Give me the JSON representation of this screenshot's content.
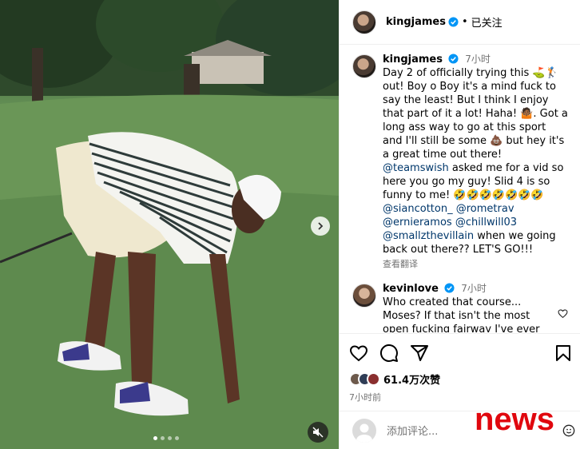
{
  "post": {
    "author": "kingjames",
    "follow_status": "已关注",
    "separator": "•",
    "caption_author": "kingjames",
    "caption_time": "7小时",
    "caption_part1": "Day 2 of officially trying this ⛳🏌 out! Boy o Boy it's a mind fuck to say the least! But I think I enjoy that part of it a lot! Haha! 🤷🏾. Got a long ass way to go at this sport and I'll still be some 💩 but hey it's a great time out there! ",
    "mention_teamswish": "@teamswish",
    "caption_part2": " asked me for a vid so here you go my guy! Slid 4 is so funny to me! 🤣🤣🤣🤣🤣🤣🤣 ",
    "mention_siancotton": "@siancotton_",
    "mention_rometrav": "@rometrav",
    "mention_ernieramos": "@ernieramos",
    "mention_chillwill03": "@chillwill03",
    "mention_smallzthevillain": "@smallzthevillain",
    "caption_part3": " when we going back out there?? LET'S GO!!!",
    "see_translation": "查看翻译"
  },
  "comment": {
    "author": "kevinlove",
    "time": "7小时",
    "text": "Who created that course... Moses? If that isn't the most open fucking fairway I've ever"
  },
  "likes": {
    "count": "61.4万次赞",
    "posted_ago": "7小时前"
  },
  "add_comment": {
    "placeholder": "添加评论..."
  },
  "overlay": {
    "watermark": "news"
  },
  "carousel": {
    "total": 4,
    "active": 1
  },
  "colors": {
    "verified": "#0095f6",
    "mention": "#00376b",
    "watermark": "#e0070e"
  }
}
